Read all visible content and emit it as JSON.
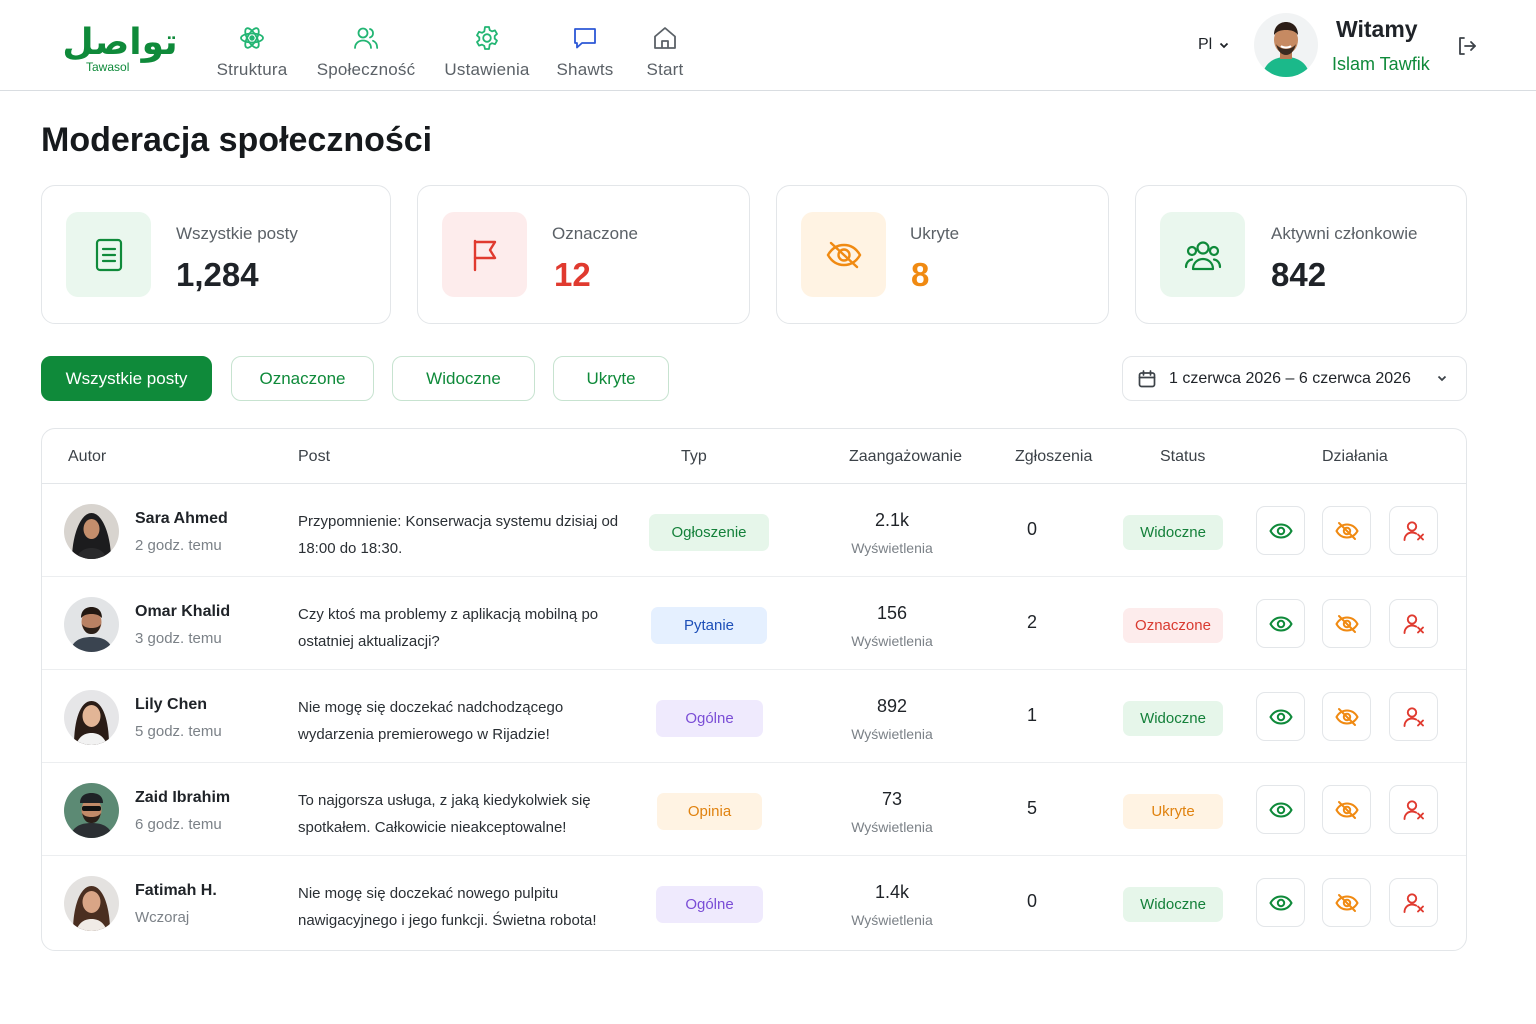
{
  "brand": {
    "logo_ar": "تواصل",
    "logo_en": "Tawasol",
    "color": "#0f8a3a"
  },
  "nav": {
    "items": [
      {
        "label": "Struktura",
        "icon": "atom-icon"
      },
      {
        "label": "Społeczność",
        "icon": "users-icon"
      },
      {
        "label": "Ustawienia",
        "icon": "gear-icon"
      },
      {
        "label": "Shawts",
        "icon": "chat-bubble-icon"
      },
      {
        "label": "Start",
        "icon": "home-icon"
      }
    ]
  },
  "header": {
    "language": "Pl",
    "greeting": "Witamy",
    "user_name": "Islam Tawfik"
  },
  "page": {
    "title": "Moderacja społeczności"
  },
  "stats": [
    {
      "label": "Wszystkie posty",
      "value": "1,284",
      "icon": "document-icon",
      "color": "#1f2328",
      "bg": "#eaf7ee"
    },
    {
      "label": "Oznaczone",
      "value": "12",
      "icon": "flag-icon",
      "color": "#e03a2f",
      "bg": "#fdecec"
    },
    {
      "label": "Ukryte",
      "value": "8",
      "icon": "eye-off-icon",
      "color": "#f08a12",
      "bg": "#fff3e3"
    },
    {
      "label": "Aktywni członkowie",
      "value": "842",
      "icon": "users-icon",
      "color": "#1f2328",
      "bg": "#eaf7ee"
    }
  ],
  "filters": {
    "tabs": [
      {
        "label": "Wszystkie posty",
        "active": true
      },
      {
        "label": "Oznaczone",
        "active": false
      },
      {
        "label": "Widoczne",
        "active": false
      },
      {
        "label": "Ukryte",
        "active": false
      }
    ],
    "date_range": "1 czerwca 2026 – 6 czerwca 2026"
  },
  "table": {
    "headers": {
      "author": "Autor",
      "post": "Post",
      "type": "Typ",
      "engagement": "Zaangażowanie",
      "reports": "Zgłoszenia",
      "status": "Status",
      "actions": "Działania"
    },
    "rows": [
      {
        "author": "Sara Ahmed",
        "time": "2 godz. temu",
        "post": "Przypomnienie: Konserwacja systemu dzisiaj od 18:00 do 18:30.",
        "type": "Ogłoszenie",
        "engagement": "2.1k",
        "engagement_label": "Wyświetlenia",
        "reports": "0",
        "status": "Widoczne"
      },
      {
        "author": "Omar Khalid",
        "time": "3 godz. temu",
        "post": "Czy ktoś ma problemy z aplikacją mobilną po ostatniej aktualizacji?",
        "type": "Pytanie",
        "engagement": "156",
        "engagement_label": "Wyświetlenia",
        "reports": "2",
        "status": "Oznaczone"
      },
      {
        "author": "Lily Chen",
        "time": "5 godz. temu",
        "post": "Nie mogę się doczekać nadchodzącego wydarzenia premierowego w Rijadzie!",
        "type": "Ogólne",
        "engagement": "892",
        "engagement_label": "Wyświetlenia",
        "reports": "1",
        "status": "Widoczne"
      },
      {
        "author": "Zaid Ibrahim",
        "time": "6 godz. temu",
        "post": "To najgorsza usługa, z jaką kiedykolwiek się spotkałem. Całkowicie nieakceptowalne!",
        "type": "Opinia",
        "engagement": "73",
        "engagement_label": "Wyświetlenia",
        "reports": "5",
        "status": "Ukryte"
      },
      {
        "author": "Fatimah H.",
        "time": "Wczoraj",
        "post": "Nie mogę się doczekać nowego pulpitu nawigacyjnego i jego funkcji. Świetna robota!",
        "type": "Ogólne",
        "engagement": "1.4k",
        "engagement_label": "Wyświetlenia",
        "reports": "0",
        "status": "Widoczne"
      }
    ]
  },
  "colors": {
    "accent": "#0f8a3a",
    "type_announcement": {
      "bg": "#e6f6ea",
      "fg": "#14803a"
    },
    "type_question": {
      "bg": "#e5f0ff",
      "fg": "#1d4fb8"
    },
    "type_general": {
      "bg": "#efeafd",
      "fg": "#7a4dd6"
    },
    "type_opinion": {
      "bg": "#fff3e3",
      "fg": "#e0820f"
    },
    "status_visible": {
      "bg": "#e6f6ea",
      "fg": "#14803a"
    },
    "status_flagged": {
      "bg": "#fdecec",
      "fg": "#d93a30"
    },
    "status_hidden": {
      "bg": "#fff3e3",
      "fg": "#e0820f"
    }
  }
}
